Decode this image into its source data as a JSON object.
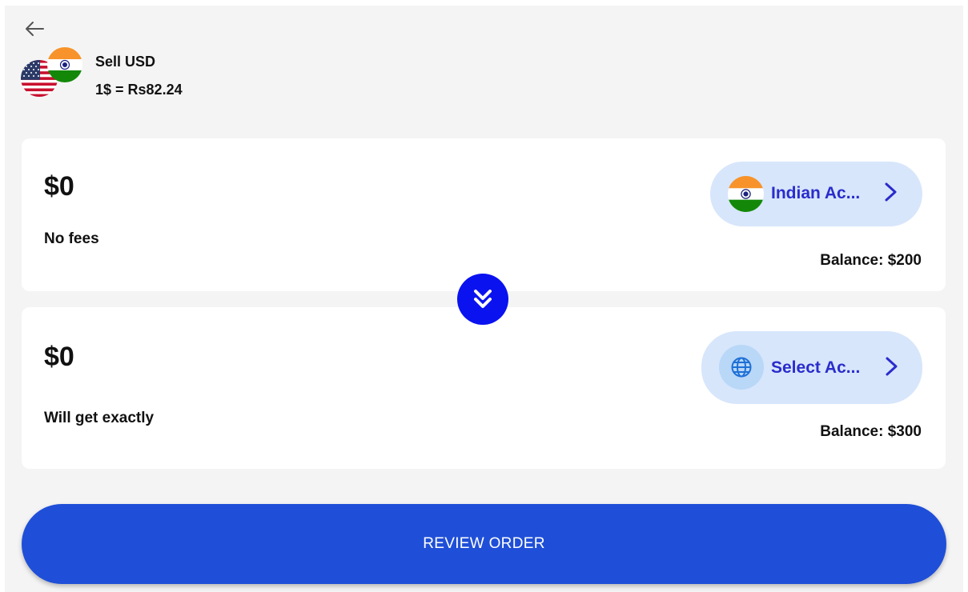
{
  "header": {
    "back_icon": "arrow-left-icon",
    "title": "Sell USD",
    "rate": "1$ = Rs82.24",
    "from_flag_icon": "us-flag-icon",
    "to_flag_icon": "india-flag-icon"
  },
  "send": {
    "amount": "$0",
    "note": "No fees",
    "account_label": "Indian Ac...",
    "account_icon": "india-flag-icon",
    "balance": "Balance: $200"
  },
  "swap": {
    "icon": "double-chevron-down-icon",
    "color": "#0a12f0"
  },
  "receive": {
    "amount": "$0",
    "note": "Will get exactly",
    "account_label": "Select Ac...",
    "account_icon": "globe-icon",
    "balance": "Balance: $300"
  },
  "review_button": {
    "label": "REVIEW ORDER",
    "color": "#1f4fd8"
  },
  "colors": {
    "background": "#f4f4f5",
    "account_pill": "#d7e6fb",
    "account_text": "#2a2ccc"
  }
}
